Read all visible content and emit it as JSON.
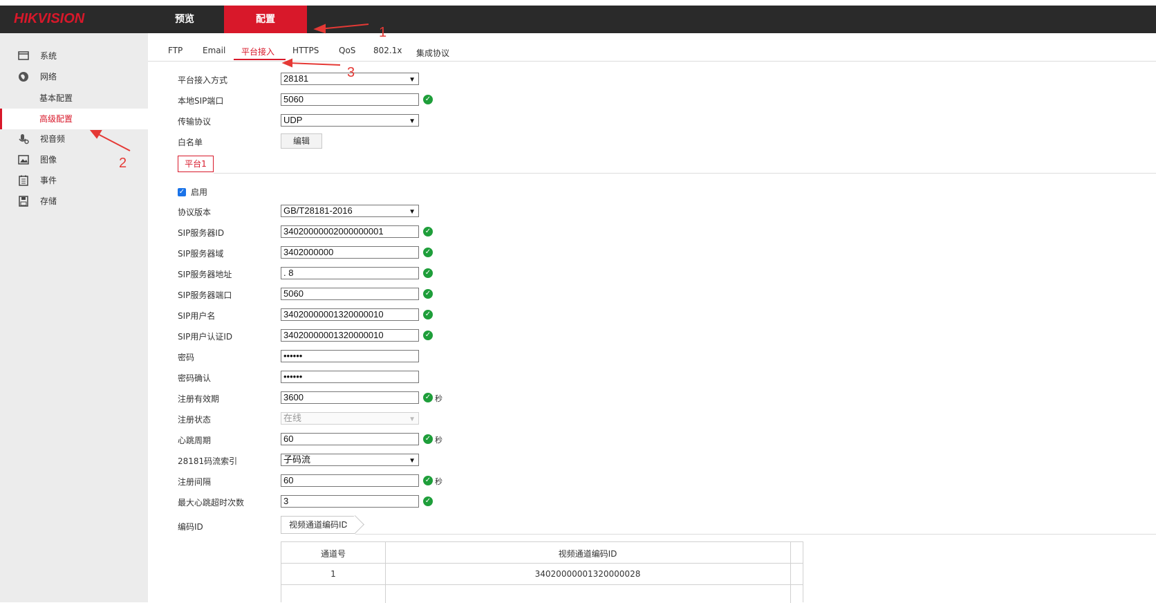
{
  "header": {
    "logo": "HIKVISION",
    "nav": [
      {
        "label": "预览",
        "active": false
      },
      {
        "label": "配置",
        "active": true
      }
    ]
  },
  "sidebar": {
    "items": [
      {
        "label": "系统",
        "icon": "monitor-icon"
      },
      {
        "label": "网络",
        "icon": "globe-icon"
      },
      {
        "label": "基本配置",
        "sub": true
      },
      {
        "label": "高级配置",
        "sub": true,
        "active": true
      },
      {
        "label": "视音频",
        "icon": "mic-icon"
      },
      {
        "label": "图像",
        "icon": "image-icon"
      },
      {
        "label": "事件",
        "icon": "calendar-icon"
      },
      {
        "label": "存储",
        "icon": "disk-icon"
      }
    ]
  },
  "tabs": [
    "FTP",
    "Email",
    "平台接入",
    "HTTPS",
    "QoS",
    "802.1x",
    "集成协议"
  ],
  "active_tab": "平台接入",
  "form": {
    "access_mode": {
      "label": "平台接入方式",
      "value": "28181"
    },
    "sip_port": {
      "label": "本地SIP端口",
      "value": "5060"
    },
    "transport": {
      "label": "传输协议",
      "value": "UDP"
    },
    "whitelist": {
      "label": "白名单",
      "button": "编辑"
    },
    "platform_tab": "平台1",
    "enable": {
      "label": "启用",
      "checked": true
    },
    "protocol_version": {
      "label": "协议版本",
      "value": "GB/T28181-2016"
    },
    "sip_server_id": {
      "label": "SIP服务器ID",
      "value": "34020000002000000001"
    },
    "sip_server_domain": {
      "label": "SIP服务器域",
      "value": "3402000000"
    },
    "sip_server_addr": {
      "label": "SIP服务器地址",
      "value": ".            8"
    },
    "sip_server_port": {
      "label": "SIP服务器端口",
      "value": "5060"
    },
    "sip_username": {
      "label": "SIP用户名",
      "value": "34020000001320000010"
    },
    "sip_auth_id": {
      "label": "SIP用户认证ID",
      "value": "34020000001320000010"
    },
    "password": {
      "label": "密码",
      "value": "••••••"
    },
    "password_confirm": {
      "label": "密码确认",
      "value": "••••••"
    },
    "reg_validity": {
      "label": "注册有效期",
      "value": "3600",
      "unit": "秒"
    },
    "reg_status": {
      "label": "注册状态",
      "value": "在线"
    },
    "heartbeat": {
      "label": "心跳周期",
      "value": "60",
      "unit": "秒"
    },
    "stream_index": {
      "label": "28181码流索引",
      "value": "子码流"
    },
    "reg_interval": {
      "label": "注册间隔",
      "value": "60",
      "unit": "秒"
    },
    "max_heartbeat_timeout": {
      "label": "最大心跳超时次数",
      "value": "3"
    },
    "encode_id": {
      "label": "编码ID",
      "tab": "视频通道编码ID"
    }
  },
  "table": {
    "headers": [
      "通道号",
      "视频通道编码ID"
    ],
    "rows": [
      {
        "channel": "1",
        "code_id": "34020000001320000028"
      }
    ]
  },
  "annotations": [
    "1",
    "2",
    "3"
  ],
  "colors": {
    "accent": "#d8182a",
    "ok": "#1e9e3a",
    "annotation": "#e53935"
  }
}
